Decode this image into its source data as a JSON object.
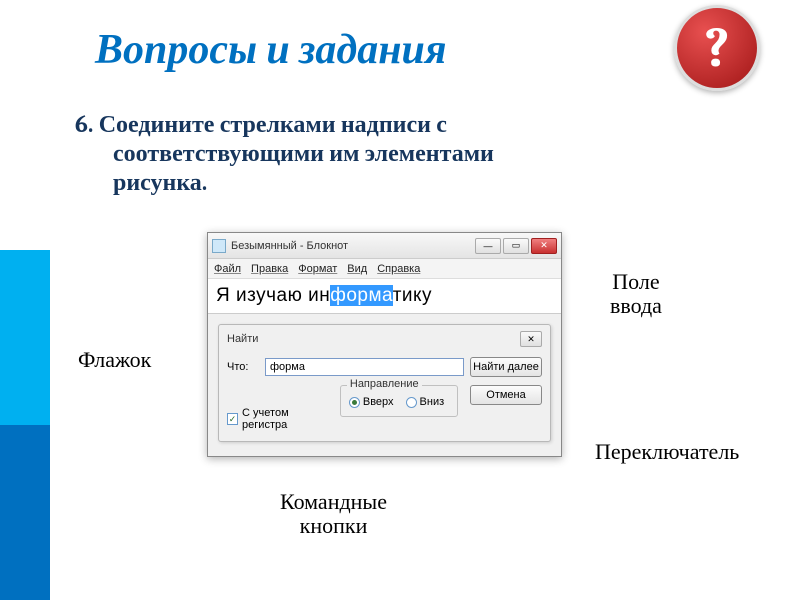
{
  "title": "Вопросы и задания",
  "badge": "?",
  "task": {
    "num": "6. ",
    "line1": "Соедините стрелками надписи с",
    "line2": "соответствующими им элементами",
    "line3": "рисунка."
  },
  "notepad": {
    "title": "Безымянный - Блокнот",
    "menu": [
      "Файл",
      "Правка",
      "Формат",
      "Вид",
      "Справка"
    ],
    "text_before": "Я изучаю ин",
    "text_hl": "форма",
    "text_after": "тику",
    "min": "—",
    "max": "▭",
    "close": "✕"
  },
  "find": {
    "title": "Найти",
    "close": "✕",
    "what_label": "Что:",
    "what_value": "форма",
    "btn_next": "Найти далее",
    "btn_cancel": "Отмена",
    "direction_legend": "Направление",
    "opt_up": "Вверх",
    "opt_down": "Вниз",
    "chk_case": "С учетом регистра"
  },
  "labels": {
    "flag": "Флажок",
    "pole_l1": "Поле",
    "pole_l2": "ввода",
    "switch": "Переключатель",
    "cmd_l1": "Командные",
    "cmd_l2": "кнопки"
  }
}
